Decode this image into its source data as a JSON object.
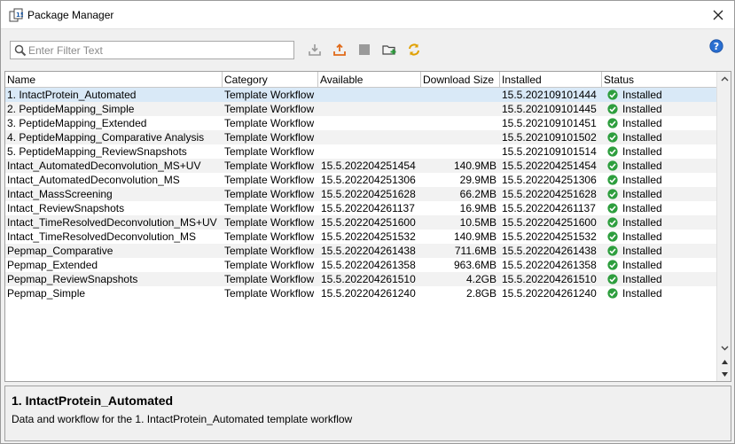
{
  "window": {
    "title": "Package Manager"
  },
  "toolbar": {
    "filter_placeholder": "Enter Filter Text",
    "buttons": [
      "download-icon",
      "upload-icon",
      "stop-icon",
      "add-folder-icon",
      "refresh-icon"
    ],
    "help_icon": "help-icon"
  },
  "table": {
    "columns": [
      "Name",
      "Category",
      "Available",
      "Download Size",
      "Installed",
      "Status"
    ],
    "rows": [
      {
        "name": "1. IntactProtein_Automated",
        "category": "Template Workflow",
        "available": "",
        "size": "",
        "installed": "15.5.202109101444",
        "status": "Installed"
      },
      {
        "name": "2. PeptideMapping_Simple",
        "category": "Template Workflow",
        "available": "",
        "size": "",
        "installed": "15.5.202109101445",
        "status": "Installed"
      },
      {
        "name": "3. PeptideMapping_Extended",
        "category": "Template Workflow",
        "available": "",
        "size": "",
        "installed": "15.5.202109101451",
        "status": "Installed"
      },
      {
        "name": "4. PeptideMapping_Comparative Analysis",
        "category": "Template Workflow",
        "available": "",
        "size": "",
        "installed": "15.5.202109101502",
        "status": "Installed"
      },
      {
        "name": "5. PeptideMapping_ReviewSnapshots",
        "category": "Template Workflow",
        "available": "",
        "size": "",
        "installed": "15.5.202109101514",
        "status": "Installed"
      },
      {
        "name": "Intact_AutomatedDeconvolution_MS+UV",
        "category": "Template Workflow",
        "available": "15.5.202204251454",
        "size": "140.9MB",
        "installed": "15.5.202204251454",
        "status": "Installed"
      },
      {
        "name": "Intact_AutomatedDeconvolution_MS",
        "category": "Template Workflow",
        "available": "15.5.202204251306",
        "size": "29.9MB",
        "installed": "15.5.202204251306",
        "status": "Installed"
      },
      {
        "name": "Intact_MassScreening",
        "category": "Template Workflow",
        "available": "15.5.202204251628",
        "size": "66.2MB",
        "installed": "15.5.202204251628",
        "status": "Installed"
      },
      {
        "name": "Intact_ReviewSnapshots",
        "category": "Template Workflow",
        "available": "15.5.202204261137",
        "size": "16.9MB",
        "installed": "15.5.202204261137",
        "status": "Installed"
      },
      {
        "name": "Intact_TimeResolvedDeconvolution_MS+UV",
        "category": "Template Workflow",
        "available": "15.5.202204251600",
        "size": "10.5MB",
        "installed": "15.5.202204251600",
        "status": "Installed"
      },
      {
        "name": "Intact_TimeResolvedDeconvolution_MS",
        "category": "Template Workflow",
        "available": "15.5.202204251532",
        "size": "140.9MB",
        "installed": "15.5.202204251532",
        "status": "Installed"
      },
      {
        "name": "Pepmap_Comparative",
        "category": "Template Workflow",
        "available": "15.5.202204261438",
        "size": "711.6MB",
        "installed": "15.5.202204261438",
        "status": "Installed"
      },
      {
        "name": "Pepmap_Extended",
        "category": "Template Workflow",
        "available": "15.5.202204261358",
        "size": "963.6MB",
        "installed": "15.5.202204261358",
        "status": "Installed"
      },
      {
        "name": "Pepmap_ReviewSnapshots",
        "category": "Template Workflow",
        "available": "15.5.202204261510",
        "size": "4.2GB",
        "installed": "15.5.202204261510",
        "status": "Installed"
      },
      {
        "name": "Pepmap_Simple",
        "category": "Template Workflow",
        "available": "15.5.202204261240",
        "size": "2.8GB",
        "installed": "15.5.202204261240",
        "status": "Installed"
      }
    ]
  },
  "details": {
    "title": "1. IntactProtein_Automated",
    "description": "Data and workflow for the 1. IntactProtein_Automated template workflow"
  },
  "colors": {
    "selected_row": "#d9e9f7",
    "status_ok": "#2e9e3e",
    "accent": "#e07b00"
  }
}
